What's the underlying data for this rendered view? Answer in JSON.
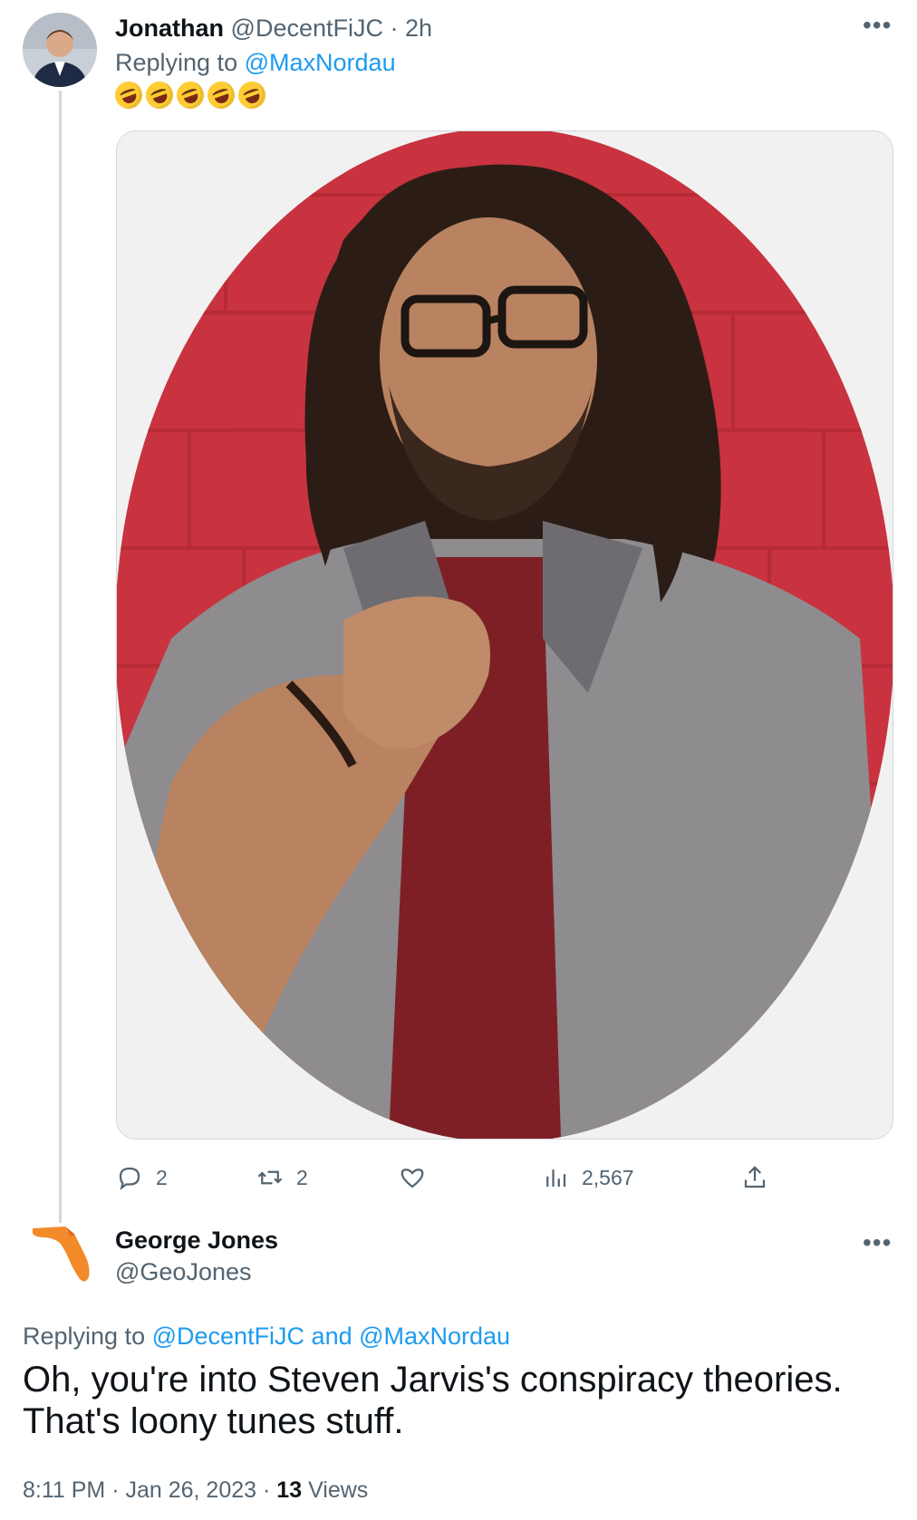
{
  "tweet1": {
    "display_name": "Jonathan",
    "handle": "@DecentFiJC",
    "separator": "·",
    "time_ago": "2h",
    "replying_prefix": "Replying to",
    "replying_to": "@MaxNordau",
    "emoji_text": "🤣🤣🤣🤣🤣",
    "actions": {
      "replies": "2",
      "retweets": "2",
      "likes": "",
      "views": "2,567"
    }
  },
  "tweet2": {
    "display_name": "George Jones",
    "handle": "@GeoJones",
    "replying_prefix": "Replying to",
    "replying_to": "@DecentFiJC and @MaxNordau",
    "text": "Oh, you're into Steven Jarvis's conspiracy theories. That's loony tunes stuff.",
    "time": "8:11 PM",
    "date": "Jan 26, 2023",
    "views_count": "13",
    "views_label": "Views"
  },
  "colors": {
    "link": "#1d9bf0",
    "muted": "#536471",
    "text": "#0f1419",
    "wall_red": "#c8333f",
    "florida_orange": "#f28a2a"
  },
  "icons": [
    "more-icon",
    "reply-icon",
    "retweet-icon",
    "like-icon",
    "views-icon",
    "share-icon",
    "florida-map-icon"
  ]
}
